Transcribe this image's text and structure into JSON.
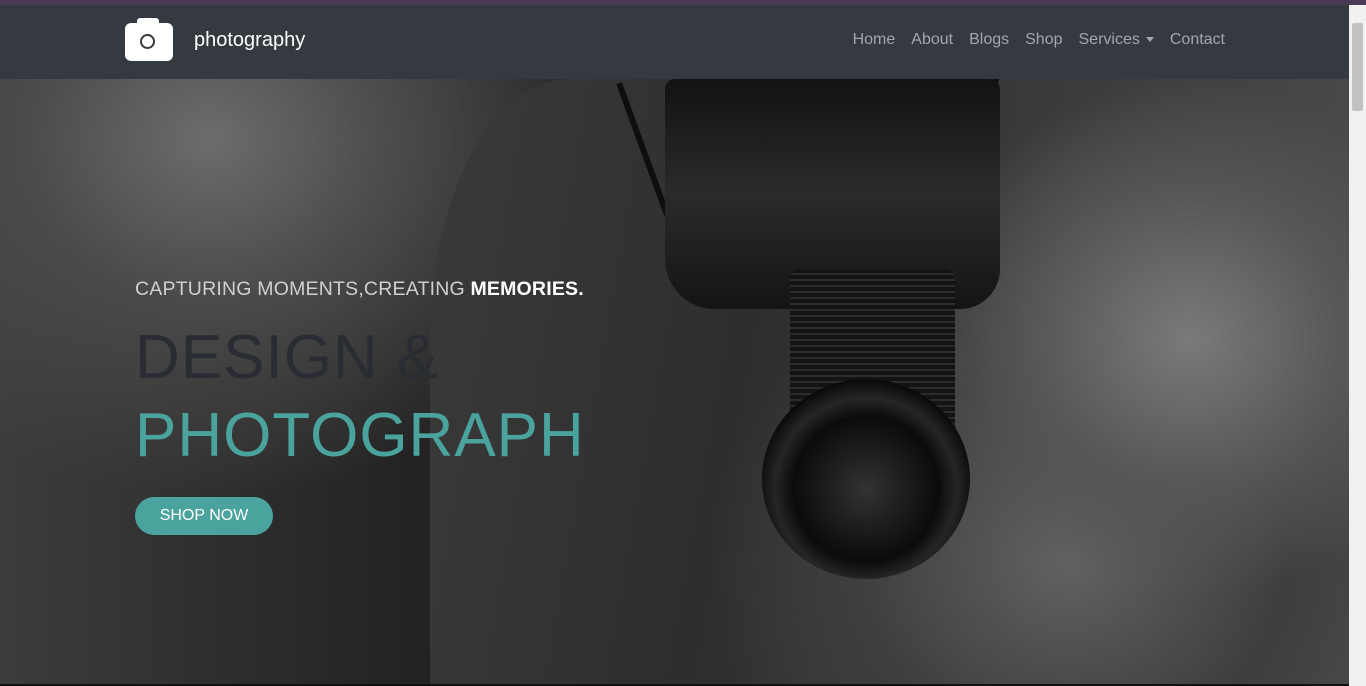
{
  "brand": {
    "icon": "camera-icon",
    "name": "photography"
  },
  "nav": {
    "items": [
      {
        "label": "Home"
      },
      {
        "label": "About"
      },
      {
        "label": "Blogs"
      },
      {
        "label": "Shop"
      },
      {
        "label": "Services",
        "has_dropdown": true
      },
      {
        "label": "Contact"
      }
    ]
  },
  "hero": {
    "tagline_prefix": "CAPTURING MOMENTS,CREATING ",
    "tagline_highlight": "MEMORIES.",
    "title_line1": "DESIGN &",
    "title_line2": "PHOTOGRAPH",
    "cta_label": "SHOP NOW"
  },
  "colors": {
    "accent": "#4aa39d",
    "navbar": "#343a40",
    "title_dark": "#2a2c33"
  }
}
